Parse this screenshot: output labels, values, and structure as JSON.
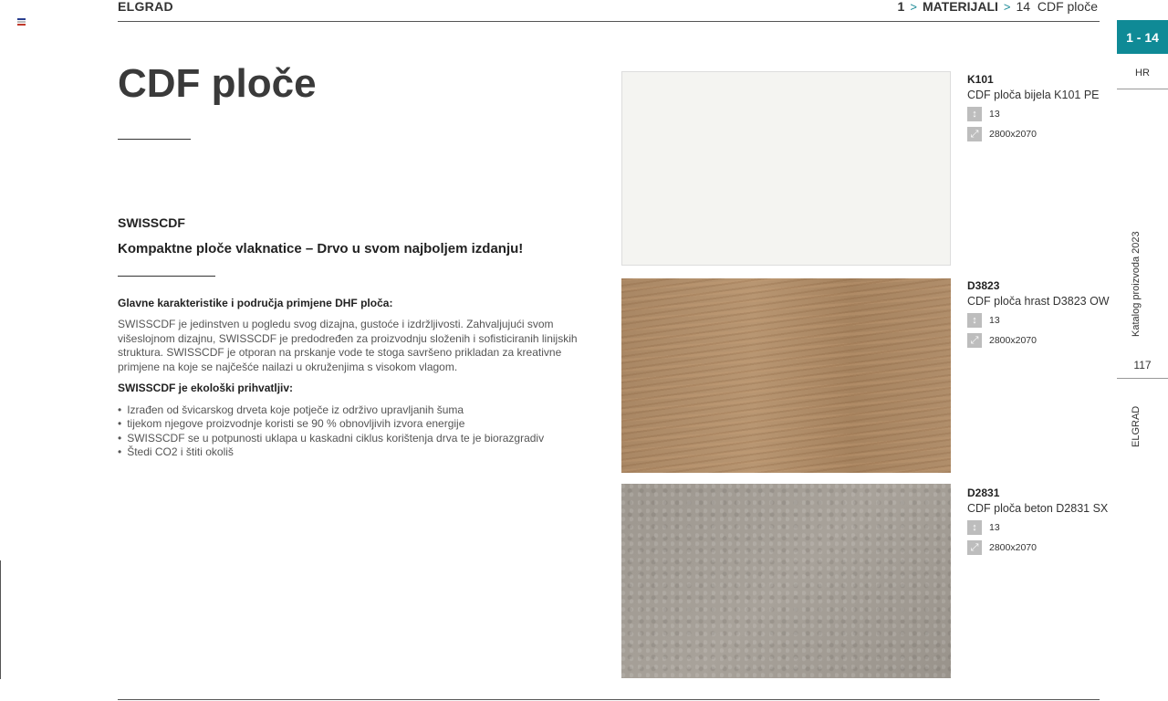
{
  "header": {
    "brand": "ELGRAD",
    "chapter_num": "1",
    "chapter": "MATERIJALI",
    "section_num": "14",
    "section": "CDF ploče"
  },
  "side": {
    "tab": "1 - 14",
    "lang": "HR",
    "catalog": "Katalog proizvoda 2023",
    "page": "117",
    "brand": "ELGRAD"
  },
  "main": {
    "title": "CDF ploče",
    "subtitle": "SWISSCDF",
    "tagline": "Kompaktne ploče vlaknatice – Drvo u svom najboljem izdanju!",
    "features_heading": "Glavne karakteristike i područja primjene DHF ploča:",
    "features_text": "SWISSCDF je jedinstven u pogledu svog dizajna, gustoće i izdržljivosti. Zahvaljujući svom višeslojnom dizajnu, SWISSCDF je predodređen za proizvodnju složenih i sofisticiranih linijskih struktura. SWISSCDF je otporan na prskanje vode te stoga savršeno prikladan za kreativne primjene na koje se najčešće nailazi u okruženjima s visokom vlagom.",
    "eco_heading": "SWISSCDF je ekološki prihvatljiv:",
    "eco_items": [
      "Izrađen od švicarskog drveta koje potječe iz održivo upravljanih šuma",
      "tijekom njegove proizvodnje koristi se 90 % obnovljivih izvora energije",
      "SWISSCDF se u potpunosti uklapa u kaskadni ciklus korištenja drva te je biorazgradiv",
      "Štedi CO2 i štiti okoliš"
    ]
  },
  "products": [
    {
      "code": "K101",
      "name": "CDF ploča bijela K101 PE",
      "thickness": "13",
      "size": "2800x2070"
    },
    {
      "code": "D3823",
      "name": "CDF ploča hrast D3823 OW",
      "thickness": "13",
      "size": "2800x2070"
    },
    {
      "code": "D2831",
      "name": "CDF ploča beton D2831 SX",
      "thickness": "13",
      "size": "2800x2070"
    }
  ],
  "colors": {
    "accent": "#0f8a96"
  }
}
